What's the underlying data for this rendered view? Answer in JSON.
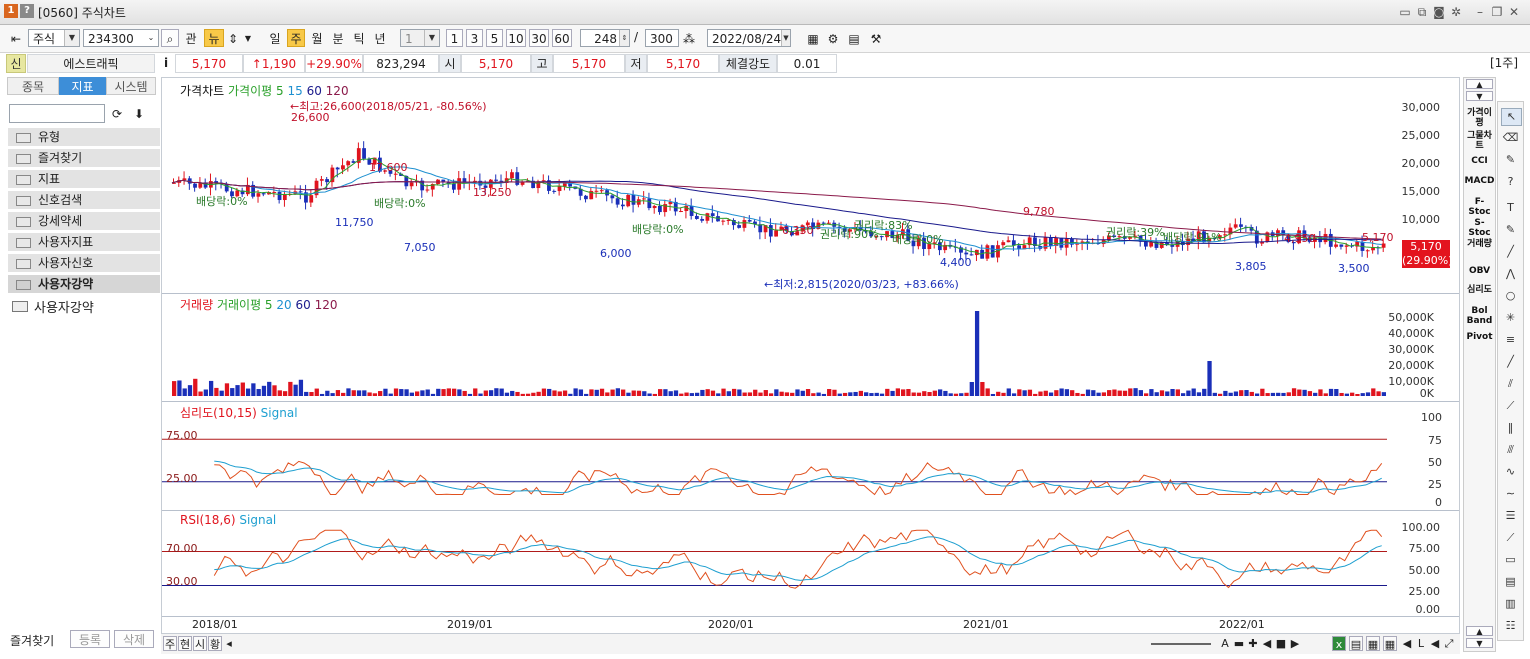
{
  "window": {
    "badge1": "1",
    "badge2": "?",
    "title": "[0560] 주식차트"
  },
  "toolbar": {
    "market": "주식",
    "code": "234300",
    "btn_gwan": "관",
    "btn_news": "뉴",
    "periods": [
      "일",
      "주",
      "월",
      "분",
      "틱",
      "년"
    ],
    "active_period": "주",
    "interval": "1",
    "intervals": [
      "1",
      "3",
      "5",
      "10",
      "30",
      "60"
    ],
    "count": "248",
    "slash": "/",
    "total": "300",
    "date": "2022/08/24"
  },
  "quote": {
    "sin": "신",
    "name": "에스트래픽",
    "info": "i",
    "price": "5,170",
    "change": "↑1,190",
    "rate": "+29.90%",
    "volume": "823,294",
    "open_label": "시",
    "open": "5,170",
    "high_label": "고",
    "high": "5,170",
    "low_label": "저",
    "low": "5,170",
    "strength_label": "체결강도",
    "strength": "0.01",
    "period_tag": "[1주]"
  },
  "left": {
    "tabs": [
      "종목",
      "지표",
      "시스템"
    ],
    "active_tab": "지표",
    "folders": [
      "유형",
      "즐겨찾기",
      "지표",
      "신호검색",
      "강세약세",
      "사용자지표",
      "사용자신호",
      "사용자강약"
    ],
    "tree_item": "사용자강약",
    "bottom": [
      "즐겨찾기",
      "등록",
      "삭제"
    ]
  },
  "price_pane": {
    "legend": [
      "가격차트",
      "가격이평 5",
      "15",
      "60",
      "120"
    ],
    "max_note": "←최고:26,600(2018/05/21, -80.56%)",
    "min_note": "←최저:2,815(2020/03/23, +83.66%)",
    "annotations": [
      "26,600",
      "17,600",
      "11,750",
      "13,250",
      "7,050",
      "6,000",
      "6,330",
      "4,400",
      "9,780",
      "4,950",
      "3,805",
      "3,500",
      "5,170"
    ],
    "event_labels": [
      "배당락:0%",
      "배당락:0%",
      "배당락:0%",
      "권리락:90%",
      "권리락:83%",
      "배당락:0%",
      "권리락:39%",
      "배당락:91%"
    ],
    "last_price": "5,170",
    "last_rate": "(29.90%)",
    "yaxis": [
      "30,000",
      "25,000",
      "20,000",
      "15,000",
      "10,000",
      "5,000"
    ]
  },
  "volume_pane": {
    "legend": [
      "거래량",
      "거래이평 5",
      "20",
      "60",
      "120"
    ],
    "yaxis": [
      "50,000K",
      "40,000K",
      "30,000K",
      "20,000K",
      "10,000K",
      "0K"
    ]
  },
  "psy_pane": {
    "legend": [
      "심리도(10,15)",
      "Signal"
    ],
    "levels": [
      "75.00",
      "25.00"
    ],
    "yaxis": [
      "100",
      "75",
      "50",
      "25",
      "0"
    ]
  },
  "rsi_pane": {
    "legend": [
      "RSI(18,6)",
      "Signal"
    ],
    "levels": [
      "70.00",
      "30.00"
    ],
    "yaxis": [
      "100.00",
      "75.00",
      "50.00",
      "25.00",
      "0.00"
    ]
  },
  "xaxis": [
    "2018/01",
    "2019/01",
    "2020/01",
    "2021/01",
    "2022/01"
  ],
  "bottom_tabs": [
    "주",
    "현",
    "시",
    "황"
  ],
  "indicator_strip": [
    "가격이평",
    "그물차트",
    "CCI",
    "MACD",
    "F-Stoc",
    "S-Stoc",
    "거래량",
    "OBV",
    "심리도",
    "Bol Band",
    "Pivot"
  ],
  "colors": {
    "up": "#e0141e",
    "down": "#1a2fb8",
    "ma5": "#2aa02a",
    "ma15": "#1e90d0",
    "ma60": "#1a1a8c",
    "ma120": "#8b1a4a",
    "accent": "#3d8ed8"
  }
}
